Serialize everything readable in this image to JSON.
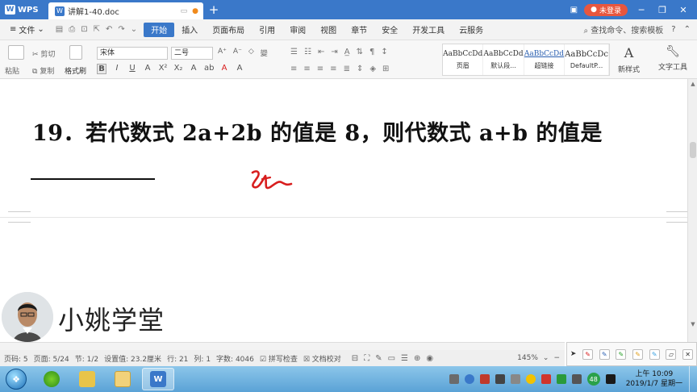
{
  "titlebar": {
    "app_name": "WPS",
    "doc_tab": "讲解1-40.doc",
    "new_tab": "+",
    "login": "未登录",
    "minimize": "─",
    "restore": "❐",
    "close": "✕"
  },
  "menu": {
    "file": "文件",
    "tabs": [
      "开始",
      "插入",
      "页面布局",
      "引用",
      "审阅",
      "视图",
      "章节",
      "安全",
      "开发工具",
      "云服务"
    ],
    "search": "查找命令、搜索模板"
  },
  "ribbon": {
    "paste": "粘贴",
    "cut": "剪切",
    "copy": "复制",
    "format_painter": "格式刷",
    "font_name": "宋体",
    "font_size": "二号",
    "styles": [
      {
        "sample": "AaBbCcDd",
        "name": "页眉"
      },
      {
        "sample": "AaBbCcDd",
        "name": "默认段..."
      },
      {
        "sample": "AaBbCcDd",
        "name": "超链接"
      },
      {
        "sample": "AaBbCcDc",
        "name": "DefaultP..."
      }
    ],
    "new_style": "新样式",
    "text_tools": "文字工具"
  },
  "document": {
    "question": "19．若代数式 2a+2b 的值是 8，则代数式 a+b 的值是"
  },
  "watermark": {
    "brand": "小姚学堂"
  },
  "statusbar": {
    "page_num": "页码: 5",
    "pages": "页面: 5/24",
    "section": "节: 1/2",
    "setting": "设置值: 23.2厘米",
    "row": "行: 21",
    "col": "列: 1",
    "words": "字数: 4046",
    "spellcheck": "拼写检查",
    "proofread": "文档校对",
    "zoom": "145%"
  },
  "taskbar": {
    "time": "上午 10:09",
    "date": "2019/1/7 星期一",
    "badge": "48"
  },
  "colors": {
    "title_blue": "#3a78c9",
    "login_red": "#e8563e",
    "ink_red": "#d81e1e"
  }
}
